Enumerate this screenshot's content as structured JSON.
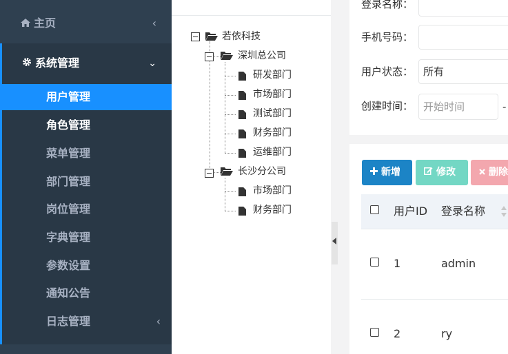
{
  "sidebar": {
    "home": {
      "label": "主页",
      "icon": "home-icon"
    },
    "system": {
      "label": "系统管理",
      "icon": "gear-icon"
    },
    "items": [
      {
        "label": "用户管理"
      },
      {
        "label": "角色管理"
      },
      {
        "label": "菜单管理"
      },
      {
        "label": "部门管理"
      },
      {
        "label": "岗位管理"
      },
      {
        "label": "字典管理"
      },
      {
        "label": "参数设置"
      },
      {
        "label": "通知公告"
      },
      {
        "label": "日志管理"
      }
    ]
  },
  "tree": {
    "root": "若依科技",
    "branch1": "深圳总公司",
    "branch1_children": [
      "研发部门",
      "市场部门",
      "测试部门",
      "财务部门",
      "运维部门"
    ],
    "branch2": "长沙分公司",
    "branch2_children": [
      "市场部门",
      "财务部门"
    ]
  },
  "search": {
    "login_name_label": "登录名称：",
    "phone_label": "手机号码：",
    "status_label": "用户状态：",
    "status_value": "所有",
    "created_label": "创建时间：",
    "start_placeholder": "开始时间",
    "dash": "-"
  },
  "toolbar": {
    "add_label": "新增",
    "edit_label": "修改",
    "delete_label": "删除"
  },
  "table": {
    "headers": [
      "用户ID",
      "登录名称"
    ],
    "rows": [
      {
        "id": "1",
        "login": "admin"
      },
      {
        "id": "2",
        "login": "ry"
      }
    ]
  }
}
